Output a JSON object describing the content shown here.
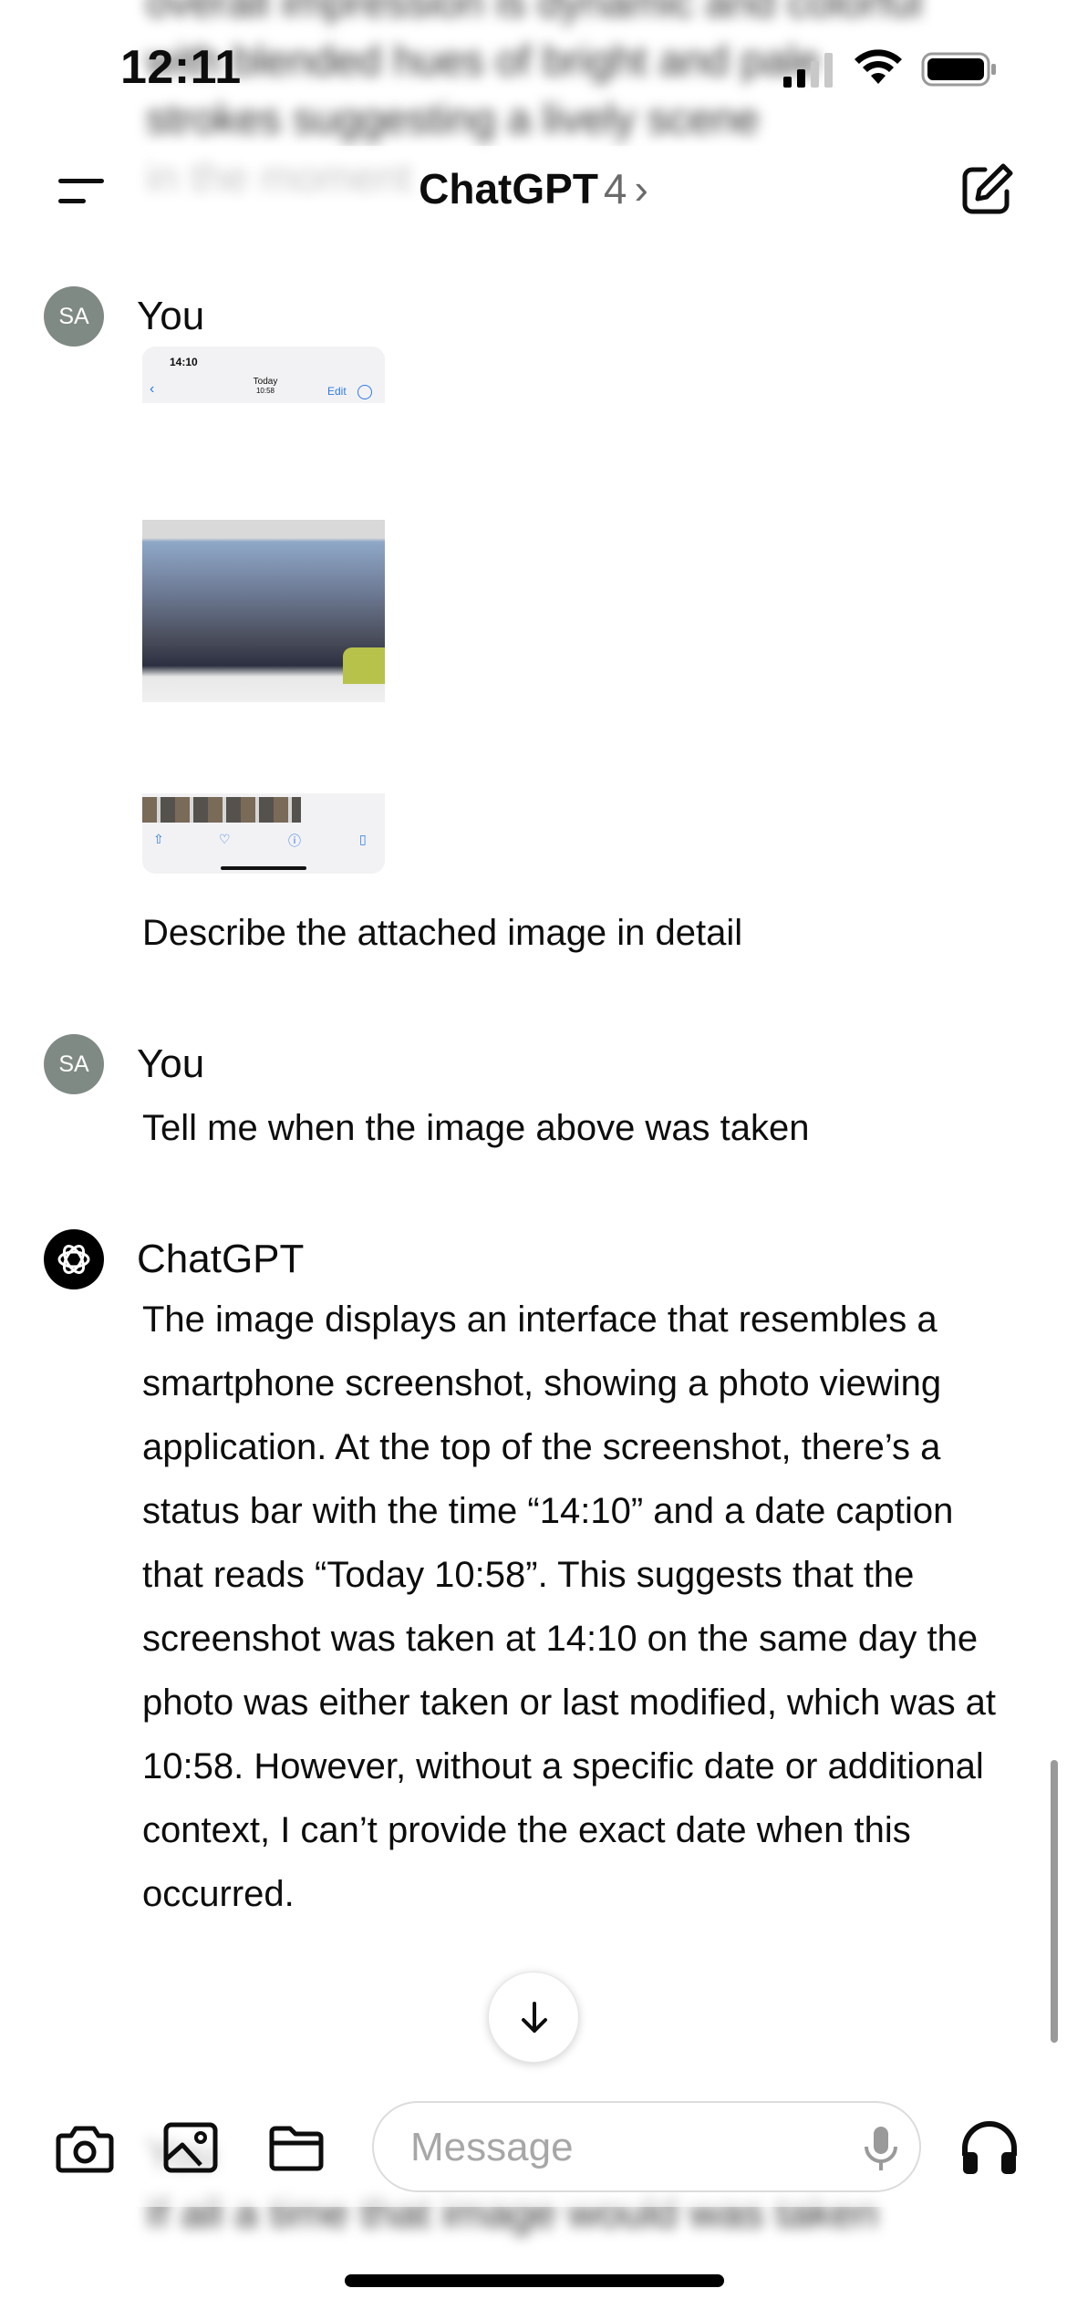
{
  "status_bar": {
    "time": "12:11"
  },
  "header": {
    "title": "ChatGPT",
    "model": "4",
    "chevron": "›"
  },
  "conversation": {
    "messages": [
      {
        "sender": "You",
        "avatar": "SA",
        "attachment": {
          "time": "14:10",
          "date_title": "Today",
          "date_time": "10:58",
          "edit_label": "Edit"
        },
        "text": "Describe the attached image in detail"
      },
      {
        "sender": "You",
        "avatar": "SA",
        "text": "Tell me when the image above was taken"
      },
      {
        "sender": "ChatGPT",
        "avatar_icon": "openai-logo-icon",
        "text": "The image displays an interface that resembles a smartphone screenshot, showing a photo viewing application. At the top of the screenshot, there’s a status bar with the time “14:10” and a date caption that reads “Today 10:58”. This suggests that the screenshot was taken at 14:10 on the same day the photo was either taken or last modified, which was at 10:58. However, without a specific date or additional context, I can’t provide the exact date when this occurred."
      }
    ]
  },
  "composer": {
    "placeholder": "Message"
  },
  "icons": {
    "menu": "menu-icon",
    "compose": "new-chat-icon",
    "camera": "camera-icon",
    "photos": "photo-library-icon",
    "files": "folder-icon",
    "mic": "microphone-icon",
    "voice": "headphones-icon",
    "scroll_down": "arrow-down-icon"
  }
}
